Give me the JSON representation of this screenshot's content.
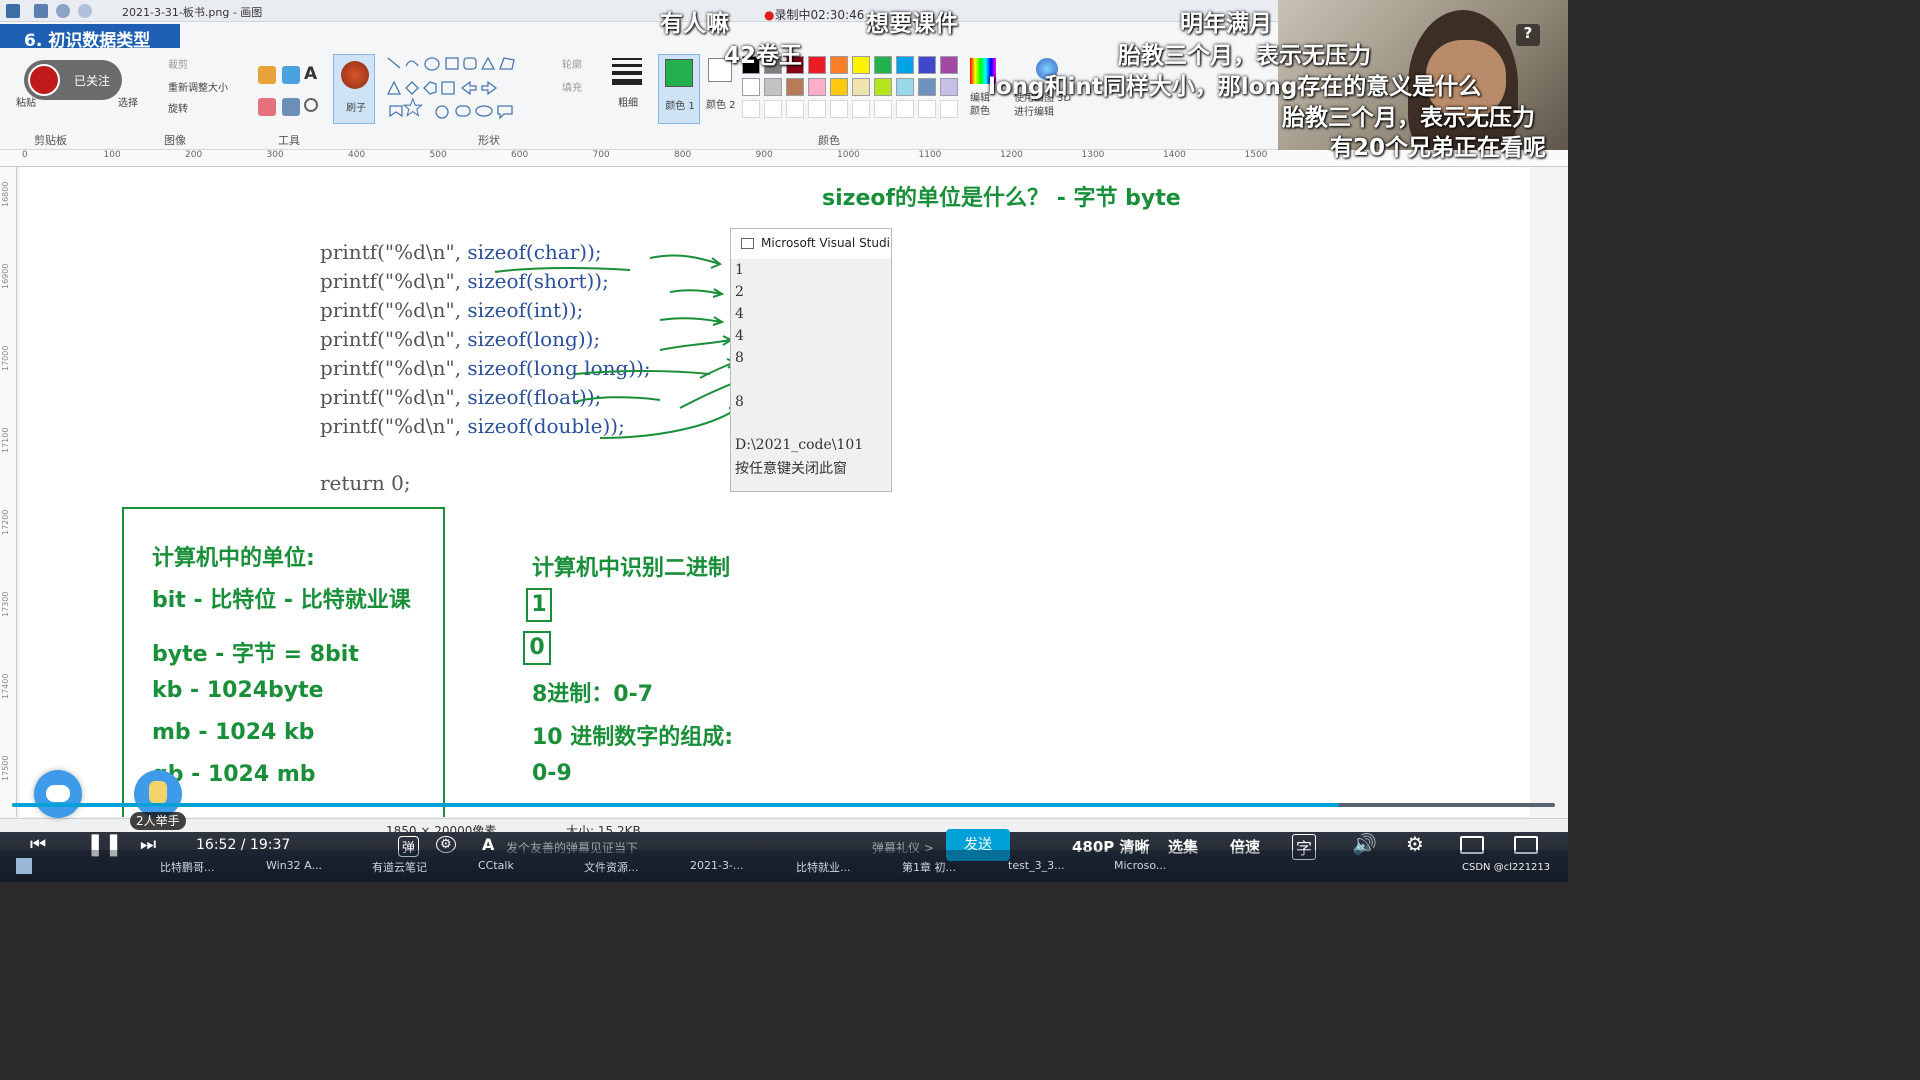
{
  "window": {
    "title": "2021-3-31-板书.png - 画图"
  },
  "video_title": "6. 初识数据类型",
  "follow": {
    "label": "已关注"
  },
  "ribbon": {
    "groups": [
      "剪贴板",
      "图像",
      "工具",
      "形状",
      "颜色"
    ],
    "paste": "粘贴",
    "select": "选择",
    "crop": "裁剪",
    "resize": "重新调整大小",
    "rotate": "旋转",
    "brush": "刷子",
    "outline": "轮廓",
    "fill": "填充",
    "size": "粗细",
    "color1": "颜色 1",
    "color2": "颜色 2",
    "edit_colors": "编辑颜色",
    "paint3d": "使用画图 3D 进行编辑"
  },
  "palette": [
    "#000000",
    "#7f7f7f",
    "#880015",
    "#ed1c24",
    "#ff7f27",
    "#fff200",
    "#22b14c",
    "#00a2e8",
    "#3f48cc",
    "#a349a4",
    "#ffffff",
    "#c3c3c3",
    "#b97a57",
    "#ffaec9",
    "#ffc90e",
    "#efe4b0",
    "#b5e61d",
    "#99d9ea",
    "#7092be",
    "#c8bfe7"
  ],
  "accent_colors": {
    "green": "#1a8f3a",
    "player_blue": "#00a1d6",
    "color1": "#22b14c"
  },
  "ruler": {
    "h_ticks": [
      "0",
      "100",
      "200",
      "300",
      "400",
      "500",
      "600",
      "700",
      "800",
      "900",
      "1000",
      "1100",
      "1200",
      "1300",
      "1400",
      "1500"
    ],
    "v_ticks": [
      "16800",
      "16900",
      "17000",
      "17100",
      "17200",
      "17300",
      "17400",
      "17500"
    ]
  },
  "board": {
    "heading": "sizeof的单位是什么？ - 字节 byte",
    "code_lines": [
      {
        "pre": "printf(\"%d\\n\", ",
        "kw": "sizeof(char));"
      },
      {
        "pre": "printf(\"%d\\n\", ",
        "kw": "sizeof(short));"
      },
      {
        "pre": "printf(\"%d\\n\", ",
        "kw": "sizeof(int));"
      },
      {
        "pre": "printf(\"%d\\n\", ",
        "kw": "sizeof(long));"
      },
      {
        "pre": "printf(\"%d\\n\", ",
        "kw": "sizeof(long long));"
      },
      {
        "pre": "printf(\"%d\\n\", ",
        "kw": "sizeof(float));"
      },
      {
        "pre": "printf(\"%d\\n\", ",
        "kw": "sizeof(double));"
      }
    ],
    "return_line": "return 0;",
    "console": {
      "title": "Microsoft Visual Studi",
      "outputs": [
        "1",
        "2",
        "4",
        "4",
        "8",
        "",
        "8"
      ],
      "path": "D:\\2021_code\\101",
      "press_key": "按任意键关闭此窗"
    },
    "units_title": "计算机中的单位:",
    "units": [
      "bit - 比特位 - 比特就业课",
      "byte - 字节 = 8bit",
      "kb - 1024byte",
      "mb - 1024 kb",
      "gb - 1024 mb"
    ],
    "binary_title": "计算机中识别二进制",
    "binary_digits": [
      "1",
      "0"
    ],
    "octal": "8进制：0-7",
    "decimal_title": "10 进制数字的组成:",
    "decimal_range": "0-9"
  },
  "danmaku": [
    "有人嘛",
    "想要课件",
    "42卷王",
    "明年满月",
    "胎教三个月，表示无压力",
    "long和int同样大小，那long存在的意义是什么",
    "胎教三个月，表示无压力",
    "有20个兄弟正在看呢"
  ],
  "recording": "录制中02:30:46",
  "status": {
    "dimensions": "1850 × 20000像素",
    "size": "大小: 15.2KB"
  },
  "player": {
    "time": "16:52 / 19:37",
    "progress": 0.86,
    "danmu_placeholder": "发个友善的弹幕见证当下",
    "danmu_etiquette": "弹幕礼仪 >",
    "send": "发送",
    "quality": "480P 清晰",
    "episodes": "选集",
    "speed": "倍速",
    "raise_hand": "2人举手"
  },
  "taskbar": [
    "比特鹏哥...",
    "Win32 A...",
    "有道云笔记",
    "CCtalk",
    "文件资源...",
    "2021-3-...",
    "比特就业...",
    "第1章 初...",
    "test_3_3...",
    "Microso..."
  ],
  "watermark": "CSDN @cl221213"
}
